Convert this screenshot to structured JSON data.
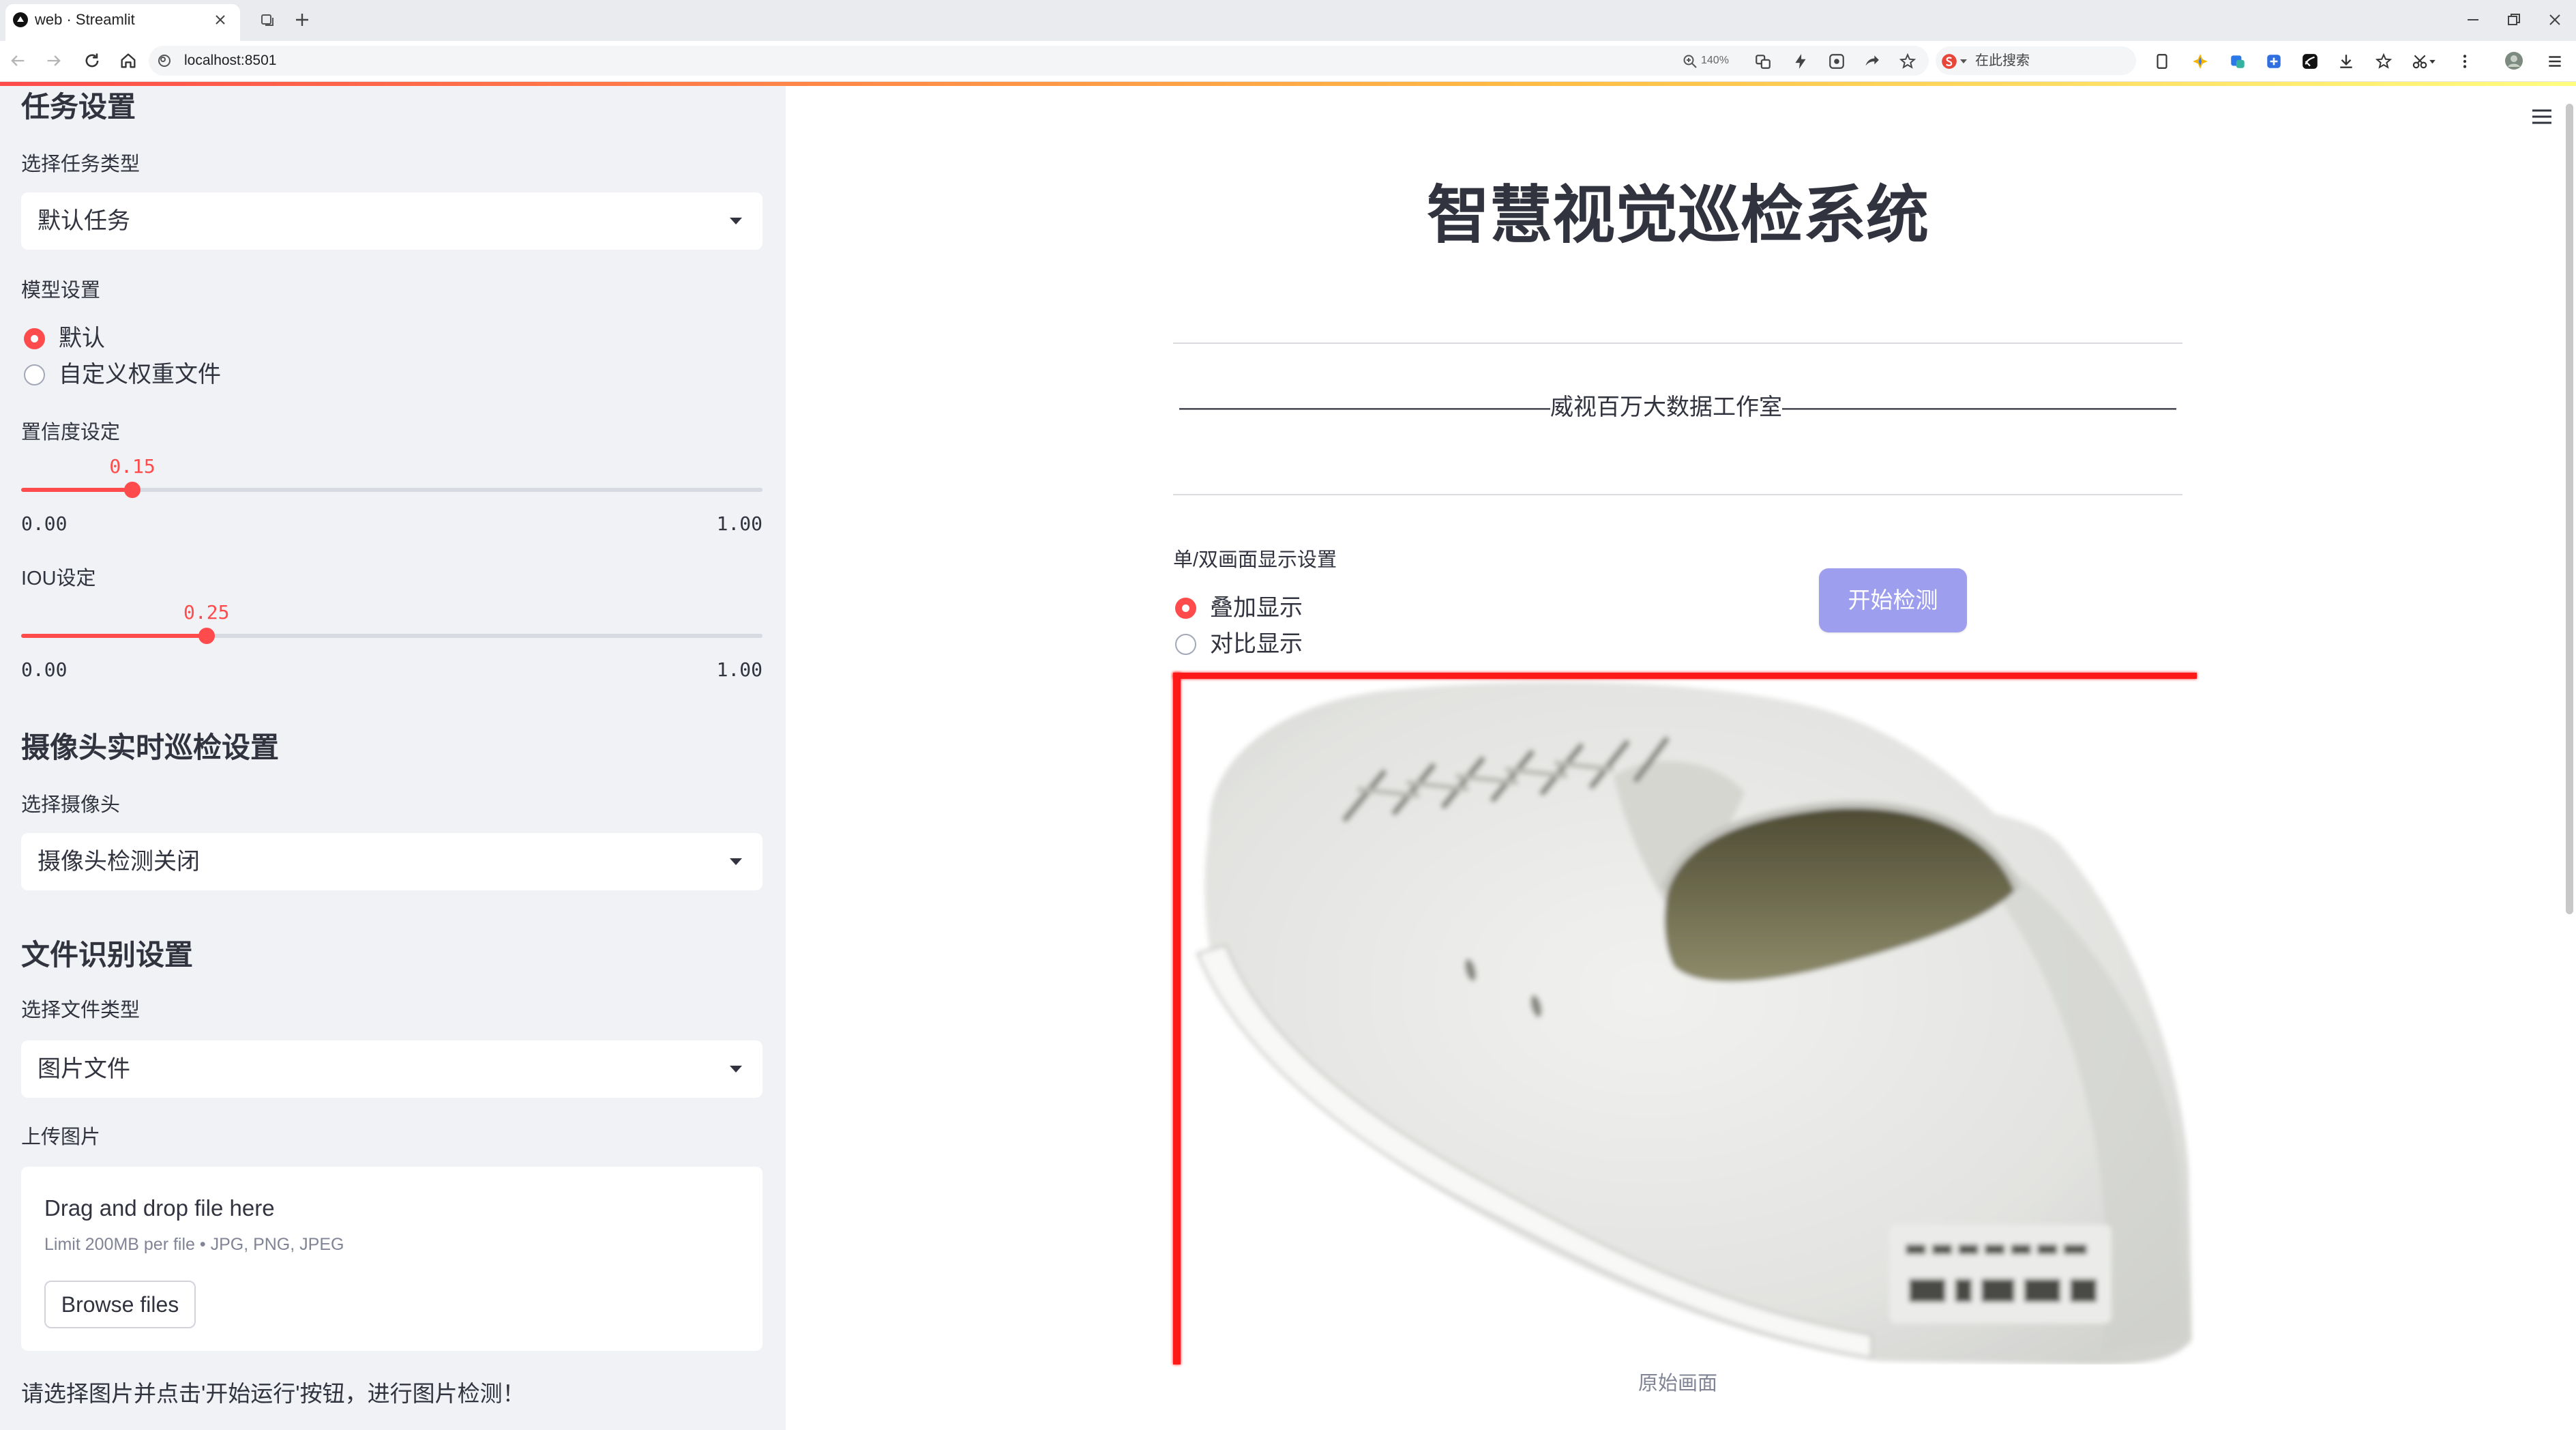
{
  "browser": {
    "tab_title": "web · Streamlit",
    "url": "localhost:8501",
    "zoom": "140%",
    "search_placeholder": "在此搜索",
    "toolbar_icons": [
      "back-icon",
      "forward-icon",
      "reload-icon",
      "home-icon",
      "zoom-icon",
      "translate-icon",
      "lightning-icon",
      "screenshot-icon",
      "share-icon",
      "star-icon",
      "search-engine-icon",
      "reader-icon",
      "extension-icon",
      "download-icon",
      "cut-icon",
      "more-icon",
      "avatar-icon",
      "menu-icon"
    ]
  },
  "sidebar": {
    "task_heading": "任务设置",
    "task_type": {
      "label": "选择任务类型",
      "value": "默认任务"
    },
    "model": {
      "label": "模型设置",
      "options": [
        {
          "label": "默认",
          "selected": true
        },
        {
          "label": "自定义权重文件",
          "selected": false
        }
      ]
    },
    "confidence": {
      "label": "置信度设定",
      "value": 0.15,
      "min": 0,
      "max": 1,
      "value_text": "0.15",
      "min_text": "0.00",
      "max_text": "1.00"
    },
    "iou": {
      "label": "IOU设定",
      "value": 0.25,
      "min": 0,
      "max": 1,
      "value_text": "0.25",
      "min_text": "0.00",
      "max_text": "1.00"
    },
    "camera_heading": "摄像头实时巡检设置",
    "camera": {
      "label": "选择摄像头",
      "value": "摄像头检测关闭"
    },
    "file_heading": "文件识别设置",
    "file_type": {
      "label": "选择文件类型",
      "value": "图片文件"
    },
    "upload": {
      "label": "上传图片",
      "drag_text": "Drag and drop file here",
      "limit_text": "Limit 200MB per file • JPG, PNG, JPEG",
      "browse_label": "Browse files"
    },
    "hint": "请选择图片并点击'开始运行'按钮，进行图片检测！"
  },
  "main": {
    "title": "智慧视觉巡检系统",
    "subtitle": "————————————————威视百万大数据工作室—————————————————",
    "display_mode": {
      "label": "单/双画面显示设置",
      "options": [
        {
          "label": "叠加显示",
          "selected": true
        },
        {
          "label": "对比显示",
          "selected": false
        }
      ]
    },
    "start_button": "开始检测",
    "image_caption": "原始画面"
  },
  "colors": {
    "accent": "#ff4b4b",
    "sidebar_bg": "#f0f2f6",
    "text": "#31333f",
    "button_bg": "#9e9eef",
    "detection_box": "#ff1a1a"
  }
}
